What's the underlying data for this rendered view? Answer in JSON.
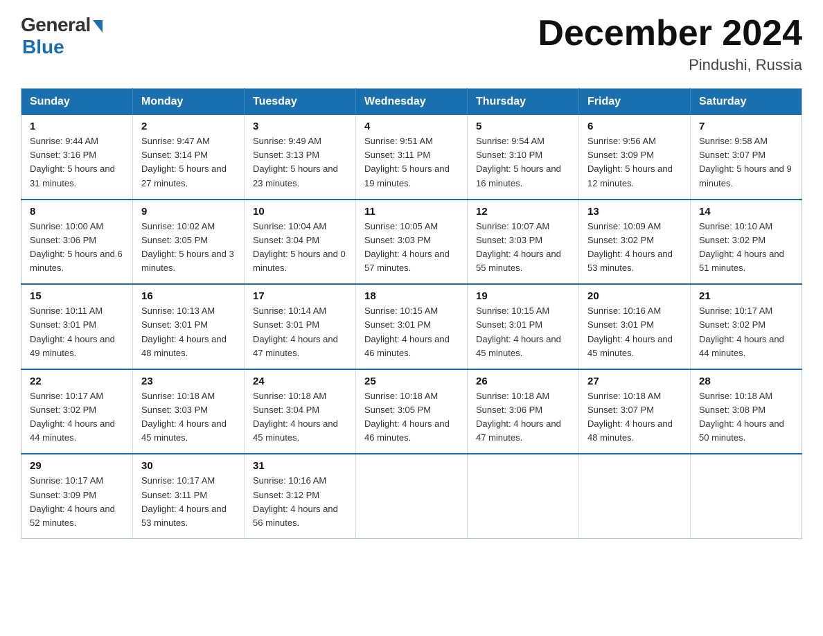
{
  "logo": {
    "general": "General",
    "blue": "Blue"
  },
  "title": "December 2024",
  "location": "Pindushi, Russia",
  "days_header": [
    "Sunday",
    "Monday",
    "Tuesday",
    "Wednesday",
    "Thursday",
    "Friday",
    "Saturday"
  ],
  "weeks": [
    [
      {
        "day": "1",
        "sunrise": "9:44 AM",
        "sunset": "3:16 PM",
        "daylight": "5 hours and 31 minutes."
      },
      {
        "day": "2",
        "sunrise": "9:47 AM",
        "sunset": "3:14 PM",
        "daylight": "5 hours and 27 minutes."
      },
      {
        "day": "3",
        "sunrise": "9:49 AM",
        "sunset": "3:13 PM",
        "daylight": "5 hours and 23 minutes."
      },
      {
        "day": "4",
        "sunrise": "9:51 AM",
        "sunset": "3:11 PM",
        "daylight": "5 hours and 19 minutes."
      },
      {
        "day": "5",
        "sunrise": "9:54 AM",
        "sunset": "3:10 PM",
        "daylight": "5 hours and 16 minutes."
      },
      {
        "day": "6",
        "sunrise": "9:56 AM",
        "sunset": "3:09 PM",
        "daylight": "5 hours and 12 minutes."
      },
      {
        "day": "7",
        "sunrise": "9:58 AM",
        "sunset": "3:07 PM",
        "daylight": "5 hours and 9 minutes."
      }
    ],
    [
      {
        "day": "8",
        "sunrise": "10:00 AM",
        "sunset": "3:06 PM",
        "daylight": "5 hours and 6 minutes."
      },
      {
        "day": "9",
        "sunrise": "10:02 AM",
        "sunset": "3:05 PM",
        "daylight": "5 hours and 3 minutes."
      },
      {
        "day": "10",
        "sunrise": "10:04 AM",
        "sunset": "3:04 PM",
        "daylight": "5 hours and 0 minutes."
      },
      {
        "day": "11",
        "sunrise": "10:05 AM",
        "sunset": "3:03 PM",
        "daylight": "4 hours and 57 minutes."
      },
      {
        "day": "12",
        "sunrise": "10:07 AM",
        "sunset": "3:03 PM",
        "daylight": "4 hours and 55 minutes."
      },
      {
        "day": "13",
        "sunrise": "10:09 AM",
        "sunset": "3:02 PM",
        "daylight": "4 hours and 53 minutes."
      },
      {
        "day": "14",
        "sunrise": "10:10 AM",
        "sunset": "3:02 PM",
        "daylight": "4 hours and 51 minutes."
      }
    ],
    [
      {
        "day": "15",
        "sunrise": "10:11 AM",
        "sunset": "3:01 PM",
        "daylight": "4 hours and 49 minutes."
      },
      {
        "day": "16",
        "sunrise": "10:13 AM",
        "sunset": "3:01 PM",
        "daylight": "4 hours and 48 minutes."
      },
      {
        "day": "17",
        "sunrise": "10:14 AM",
        "sunset": "3:01 PM",
        "daylight": "4 hours and 47 minutes."
      },
      {
        "day": "18",
        "sunrise": "10:15 AM",
        "sunset": "3:01 PM",
        "daylight": "4 hours and 46 minutes."
      },
      {
        "day": "19",
        "sunrise": "10:15 AM",
        "sunset": "3:01 PM",
        "daylight": "4 hours and 45 minutes."
      },
      {
        "day": "20",
        "sunrise": "10:16 AM",
        "sunset": "3:01 PM",
        "daylight": "4 hours and 45 minutes."
      },
      {
        "day": "21",
        "sunrise": "10:17 AM",
        "sunset": "3:02 PM",
        "daylight": "4 hours and 44 minutes."
      }
    ],
    [
      {
        "day": "22",
        "sunrise": "10:17 AM",
        "sunset": "3:02 PM",
        "daylight": "4 hours and 44 minutes."
      },
      {
        "day": "23",
        "sunrise": "10:18 AM",
        "sunset": "3:03 PM",
        "daylight": "4 hours and 45 minutes."
      },
      {
        "day": "24",
        "sunrise": "10:18 AM",
        "sunset": "3:04 PM",
        "daylight": "4 hours and 45 minutes."
      },
      {
        "day": "25",
        "sunrise": "10:18 AM",
        "sunset": "3:05 PM",
        "daylight": "4 hours and 46 minutes."
      },
      {
        "day": "26",
        "sunrise": "10:18 AM",
        "sunset": "3:06 PM",
        "daylight": "4 hours and 47 minutes."
      },
      {
        "day": "27",
        "sunrise": "10:18 AM",
        "sunset": "3:07 PM",
        "daylight": "4 hours and 48 minutes."
      },
      {
        "day": "28",
        "sunrise": "10:18 AM",
        "sunset": "3:08 PM",
        "daylight": "4 hours and 50 minutes."
      }
    ],
    [
      {
        "day": "29",
        "sunrise": "10:17 AM",
        "sunset": "3:09 PM",
        "daylight": "4 hours and 52 minutes."
      },
      {
        "day": "30",
        "sunrise": "10:17 AM",
        "sunset": "3:11 PM",
        "daylight": "4 hours and 53 minutes."
      },
      {
        "day": "31",
        "sunrise": "10:16 AM",
        "sunset": "3:12 PM",
        "daylight": "4 hours and 56 minutes."
      },
      null,
      null,
      null,
      null
    ]
  ]
}
